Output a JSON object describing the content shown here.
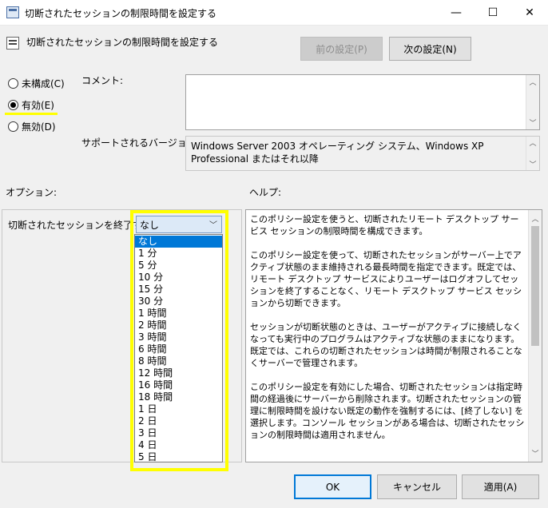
{
  "window": {
    "title": "切断されたセッションの制限時間を設定する",
    "minimize": "—",
    "maximize": "☐",
    "close": "✕"
  },
  "header": {
    "title": "切断されたセッションの制限時間を設定する",
    "prev_button": "前の設定(P)",
    "next_button": "次の設定(N)"
  },
  "state": {
    "options": [
      {
        "label": "未構成(C)",
        "checked": false
      },
      {
        "label": "有効(E)",
        "checked": true
      },
      {
        "label": "無効(D)",
        "checked": false
      }
    ]
  },
  "comment": {
    "label": "コメント:",
    "value": ""
  },
  "supported": {
    "label": "サポートされるバージョン:",
    "value": "Windows Server 2003 オペレーティング システム、Windows XP Professional またはそれ以降"
  },
  "options_section": {
    "label": "オプション:",
    "field_label": "切断されたセッションを終了する",
    "selected": "なし",
    "dropdown_items": [
      "なし",
      "1 分",
      "5 分",
      "10 分",
      "15 分",
      "30 分",
      "1 時間",
      "2 時間",
      "3 時間",
      "6 時間",
      "8 時間",
      "12 時間",
      "16 時間",
      "18 時間",
      "1 日",
      "2 日",
      "3 日",
      "4 日",
      "5 日"
    ]
  },
  "help_section": {
    "label": "ヘルプ:",
    "text": "このポリシー設定を使うと、切断されたリモート デスクトップ サービス セッションの制限時間を構成できます。\n\nこのポリシー設定を使って、切断されたセッションがサーバー上でアクティブ状態のまま維持される最長時間を指定できます。既定では、リモート デスクトップ サービスによりユーザーはログオフしてセッションを終了することなく、リモート デスクトップ サービス セッションから切断できます。\n\nセッションが切断状態のときは、ユーザーがアクティブに接続しなくなっても実行中のプログラムはアクティブな状態のままになります。既定では、これらの切断されたセッションは時間が制限されることなくサーバーで管理されます。\n\nこのポリシー設定を有効にした場合、切断されたセッションは指定時間の経過後にサーバーから削除されます。切断されたセッションの管理に制限時間を設けない既定の動作を強制するには、[終了しない] を選択します。コンソール セッションがある場合は、切断されたセッションの制限時間は適用されません。\n\n\nこのポリシー設定を無効にした場合、または構成しなかった場合、ポリシー設定はグループ ポリシー レベルでは指定されません。既定では、リモート"
  },
  "footer": {
    "ok": "OK",
    "cancel": "キャンセル",
    "apply": "適用(A)"
  },
  "colors": {
    "highlight": "#ffff00",
    "selection": "#0078d7"
  }
}
